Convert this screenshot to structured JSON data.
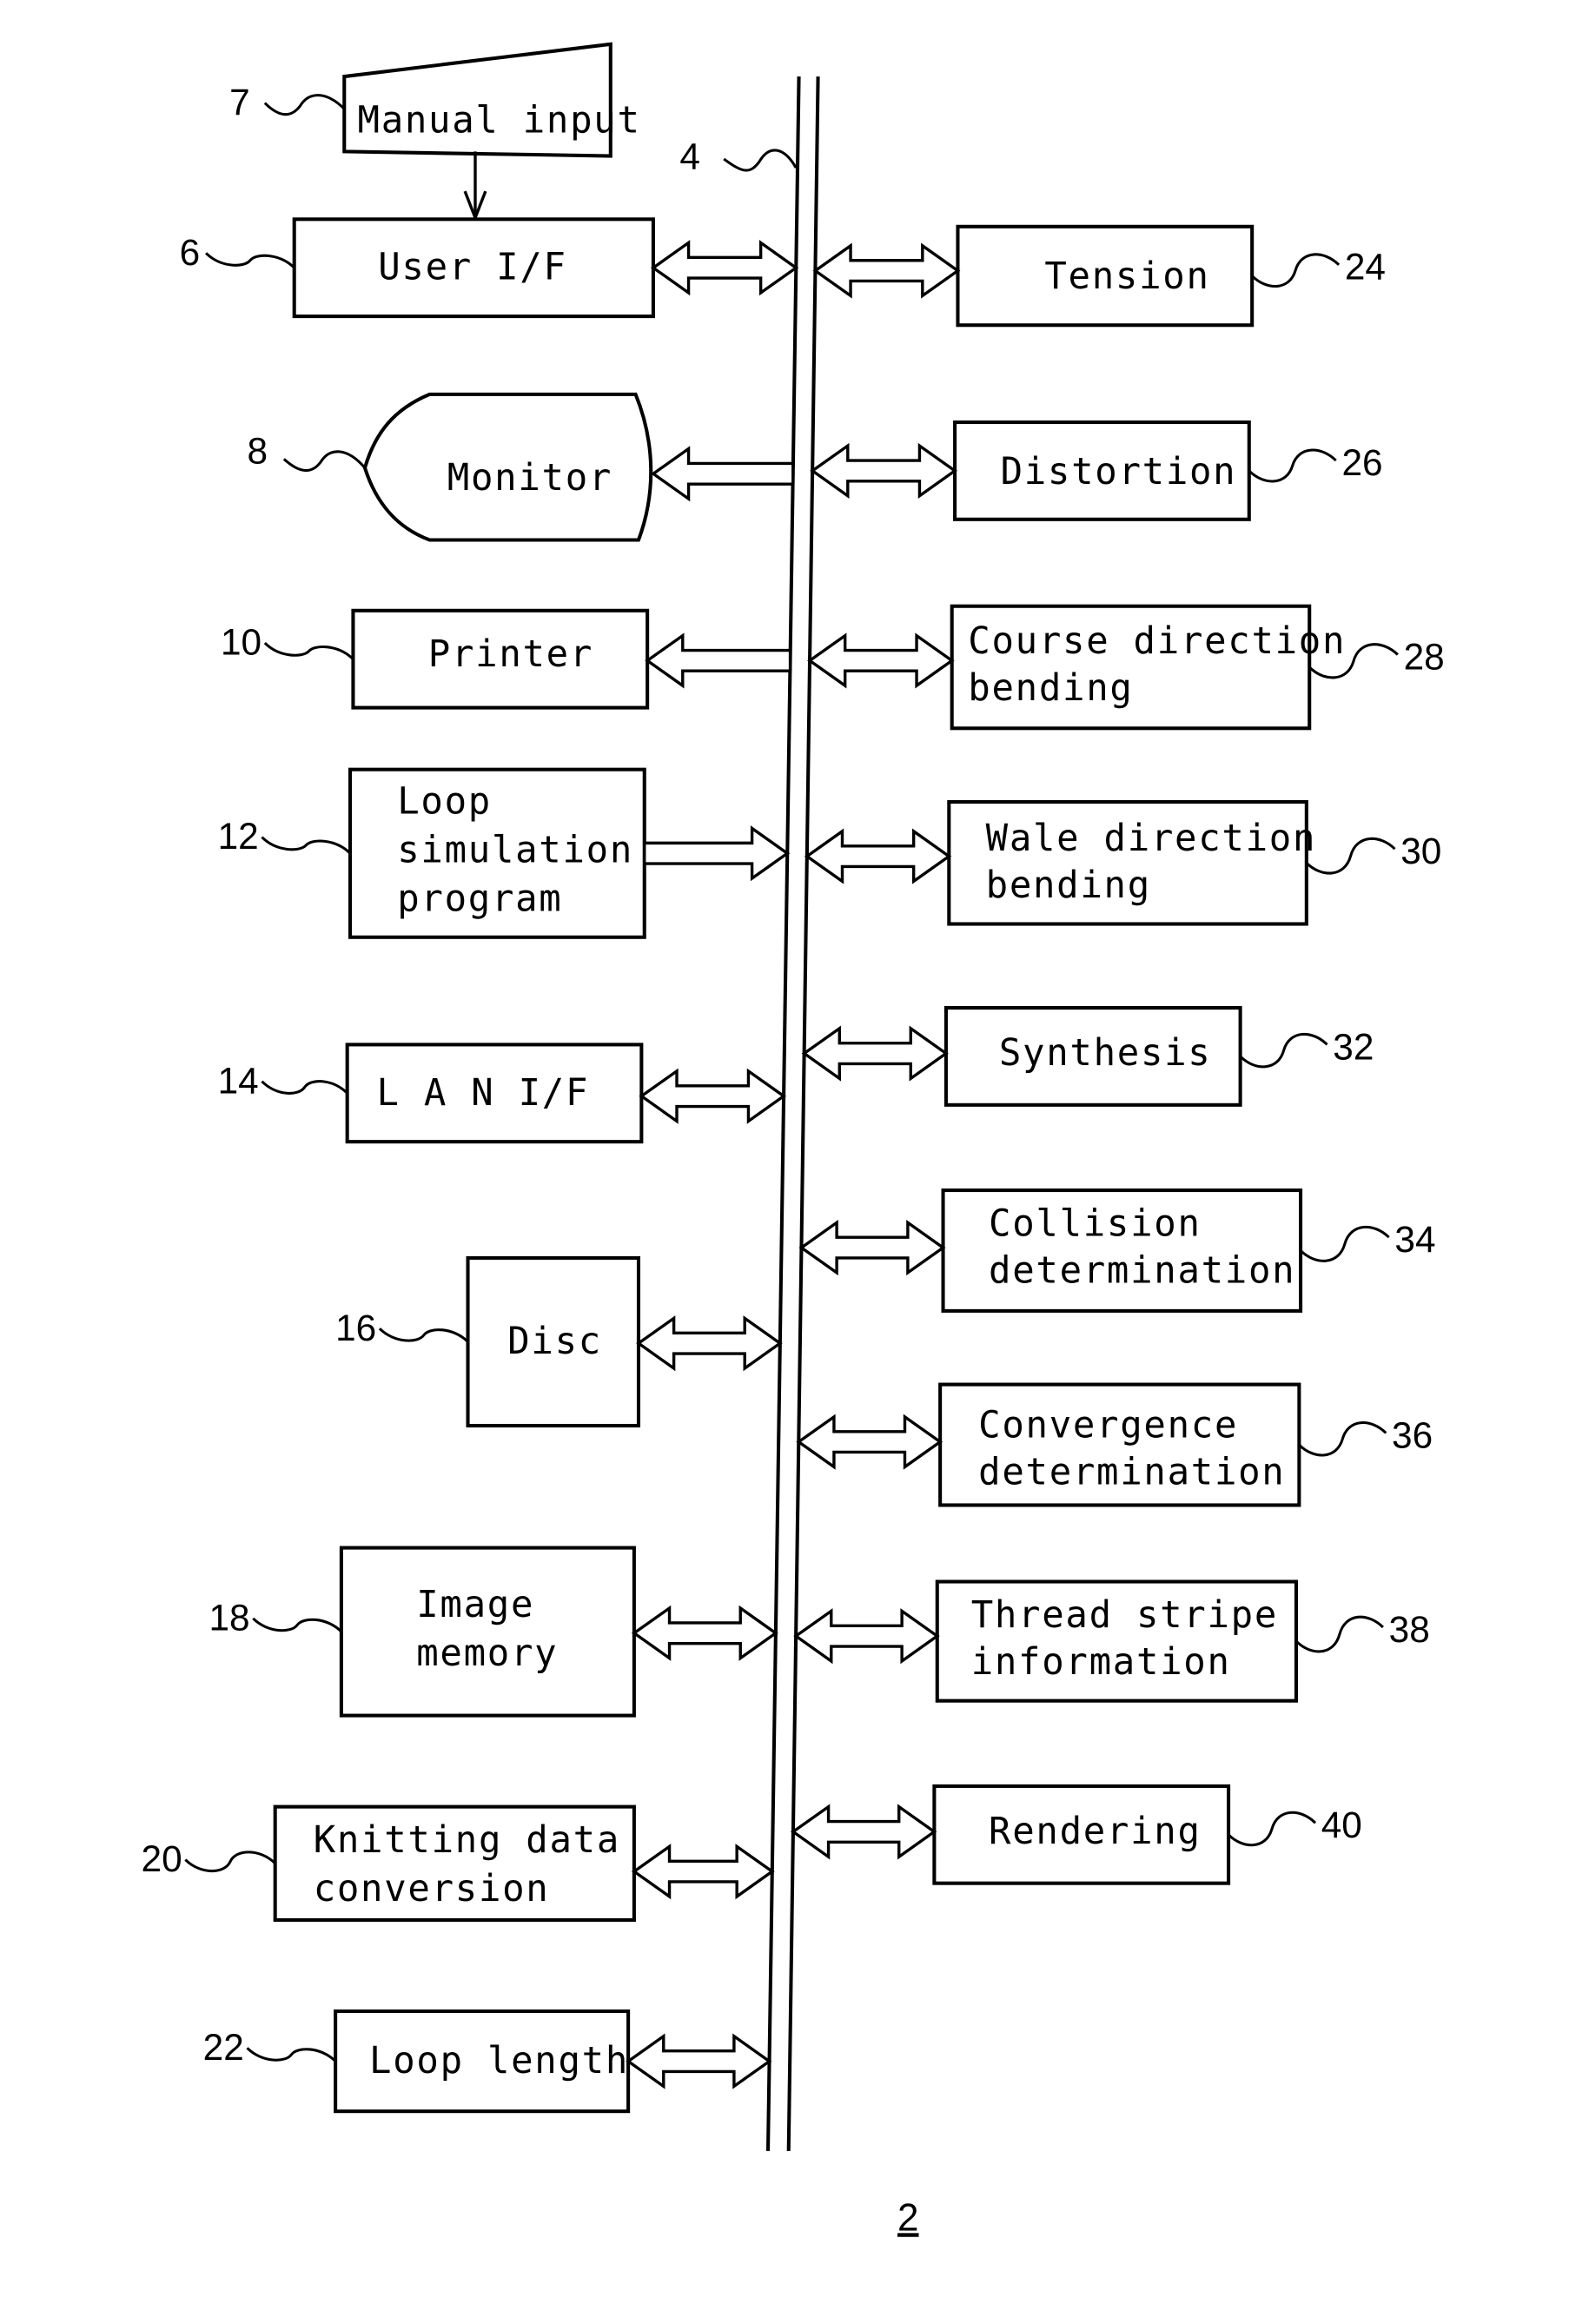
{
  "figure": {
    "number": "2",
    "bus_ref": "4"
  },
  "blocks_left": [
    {
      "id": "manual-input",
      "ref": "7",
      "lines": [
        "Manual input"
      ],
      "connection": "arrow-down-to-user-if"
    },
    {
      "id": "user-if",
      "ref": "6",
      "lines": [
        "User  I/F"
      ],
      "connection": "bidirectional"
    },
    {
      "id": "monitor",
      "ref": "8",
      "lines": [
        "Monitor"
      ],
      "connection": "from-bus"
    },
    {
      "id": "printer",
      "ref": "10",
      "lines": [
        "Printer"
      ],
      "connection": "from-bus"
    },
    {
      "id": "loop-simulation-program",
      "ref": "12",
      "lines": [
        "Loop",
        "simulation",
        "program"
      ],
      "connection": "to-bus"
    },
    {
      "id": "lan-if",
      "ref": "14",
      "lines": [
        "L A N  I/F"
      ],
      "connection": "bidirectional"
    },
    {
      "id": "disc",
      "ref": "16",
      "lines": [
        "Disc"
      ],
      "connection": "bidirectional"
    },
    {
      "id": "image-memory",
      "ref": "18",
      "lines": [
        "Image",
        "memory"
      ],
      "connection": "bidirectional"
    },
    {
      "id": "knitting-data-conversion",
      "ref": "20",
      "lines": [
        "Knitting data",
        "conversion"
      ],
      "connection": "bidirectional"
    },
    {
      "id": "loop-length",
      "ref": "22",
      "lines": [
        "Loop length"
      ],
      "connection": "bidirectional"
    }
  ],
  "blocks_right": [
    {
      "id": "tension",
      "ref": "24",
      "lines": [
        "Tension"
      ],
      "connection": "bidirectional"
    },
    {
      "id": "distortion",
      "ref": "26",
      "lines": [
        "Distortion"
      ],
      "connection": "bidirectional"
    },
    {
      "id": "course-direction-bending",
      "ref": "28",
      "lines": [
        "Course direction",
        "bending"
      ],
      "connection": "bidirectional"
    },
    {
      "id": "wale-direction-bending",
      "ref": "30",
      "lines": [
        "Wale direction",
        "bending"
      ],
      "connection": "bidirectional"
    },
    {
      "id": "synthesis",
      "ref": "32",
      "lines": [
        "Synthesis"
      ],
      "connection": "bidirectional"
    },
    {
      "id": "collision-determination",
      "ref": "34",
      "lines": [
        "Collision",
        "determination"
      ],
      "connection": "bidirectional"
    },
    {
      "id": "convergence-determination",
      "ref": "36",
      "lines": [
        "Convergence",
        "determination"
      ],
      "connection": "bidirectional"
    },
    {
      "id": "thread-stripe-information",
      "ref": "38",
      "lines": [
        "Thread stripe",
        "information"
      ],
      "connection": "bidirectional"
    },
    {
      "id": "rendering",
      "ref": "40",
      "lines": [
        "Rendering"
      ],
      "connection": "bidirectional"
    }
  ]
}
